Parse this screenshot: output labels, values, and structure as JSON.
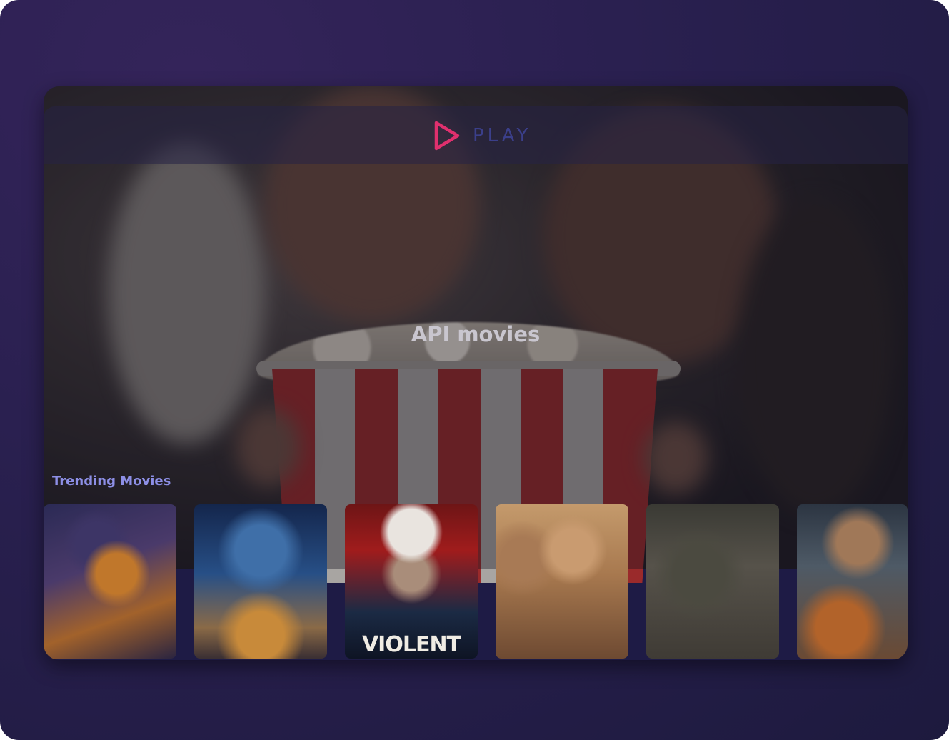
{
  "app": {
    "logo_text": "PLAY"
  },
  "hero": {
    "title": "API movies"
  },
  "trending": {
    "title": "Trending Movies",
    "movies": [
      {
        "caption": ""
      },
      {
        "caption": ""
      },
      {
        "caption": "VIOLENT"
      },
      {
        "caption": ""
      },
      {
        "caption": ""
      },
      {
        "caption": ""
      }
    ]
  },
  "colors": {
    "background": "#2a2050",
    "accent": "#e0306e",
    "logo_text": "#3b3f8a",
    "section_title": "#8d8fe6",
    "hero_title": "#c9c6cf"
  },
  "icons": {
    "logo": "play-triangle-icon"
  }
}
